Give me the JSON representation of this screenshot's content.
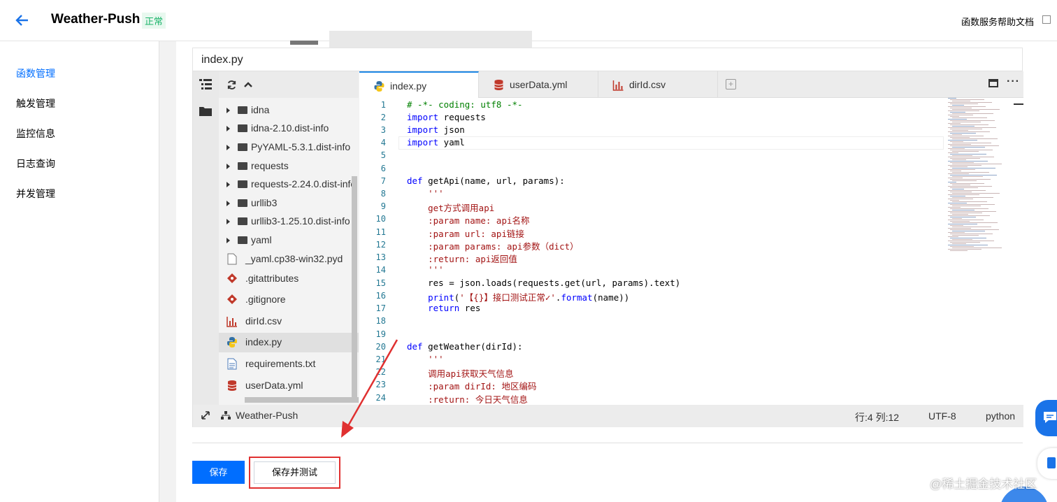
{
  "header": {
    "title": "Weather-Push",
    "status": "正常",
    "help_link": "函数服务帮助文档"
  },
  "sidebar": {
    "items": [
      {
        "label": "函数管理",
        "active": true
      },
      {
        "label": "触发管理",
        "active": false
      },
      {
        "label": "监控信息",
        "active": false
      },
      {
        "label": "日志查询",
        "active": false
      },
      {
        "label": "并发管理",
        "active": false
      }
    ]
  },
  "editor": {
    "file_header": "index.py",
    "tabs": [
      {
        "label": "index.py",
        "icon": "python-icon",
        "active": true
      },
      {
        "label": "userData.yml",
        "icon": "database-icon",
        "active": false
      },
      {
        "label": "dirId.csv",
        "icon": "chart-icon",
        "active": false
      }
    ],
    "tree": [
      {
        "label": "idna",
        "type": "folder"
      },
      {
        "label": "idna-2.10.dist-info",
        "type": "folder"
      },
      {
        "label": "PyYAML-5.3.1.dist-info",
        "type": "folder"
      },
      {
        "label": "requests",
        "type": "folder"
      },
      {
        "label": "requests-2.24.0.dist-info",
        "type": "folder"
      },
      {
        "label": "urllib3",
        "type": "folder"
      },
      {
        "label": "urllib3-1.25.10.dist-info",
        "type": "folder"
      },
      {
        "label": "yaml",
        "type": "folder"
      },
      {
        "label": "_yaml.cp38-win32.pyd",
        "type": "file"
      },
      {
        "label": ".gitattributes",
        "type": "git"
      },
      {
        "label": ".gitignore",
        "type": "git"
      },
      {
        "label": "dirId.csv",
        "type": "csv"
      },
      {
        "label": "index.py",
        "type": "python",
        "selected": true
      },
      {
        "label": "requirements.txt",
        "type": "text"
      },
      {
        "label": "userData.yml",
        "type": "yml"
      }
    ],
    "line_numbers": [
      "1",
      "2",
      "3",
      "4",
      "5",
      "6",
      "7",
      "8",
      "9",
      "10",
      "11",
      "12",
      "13",
      "14",
      "15",
      "16",
      "17",
      "18",
      "19",
      "20",
      "21",
      "22",
      "23",
      "24"
    ],
    "code": [
      "# -*- coding: utf8 -*-",
      "import requests",
      "import json",
      "import yaml",
      "",
      "",
      "def getApi(name, url, params):",
      "    '''",
      "    get方式调用api",
      "    :param name: api名称",
      "    :param url: api链接",
      "    :param params: api参数（dict）",
      "    :return: api返回值",
      "    '''",
      "    res = json.loads(requests.get(url, params).text)",
      "    print('【{}】接口测试正常✓'.format(name))",
      "    return res",
      "",
      "",
      "def getWeather(dirId):",
      "    '''",
      "    调用api获取天气信息",
      "    :param dirId: 地区编码",
      "    :return: 今日天气信息"
    ],
    "status": {
      "project": "Weather-Push",
      "position": "行:4 列:12",
      "encoding": "UTF-8",
      "language": "python"
    }
  },
  "actions": {
    "save": "保存",
    "save_and_test": "保存并测试"
  },
  "watermark": "@稀土掘金技术社区",
  "colors": {
    "accent": "#006eff",
    "status_green": "#1bb36a",
    "highlight_red": "#e03030"
  }
}
